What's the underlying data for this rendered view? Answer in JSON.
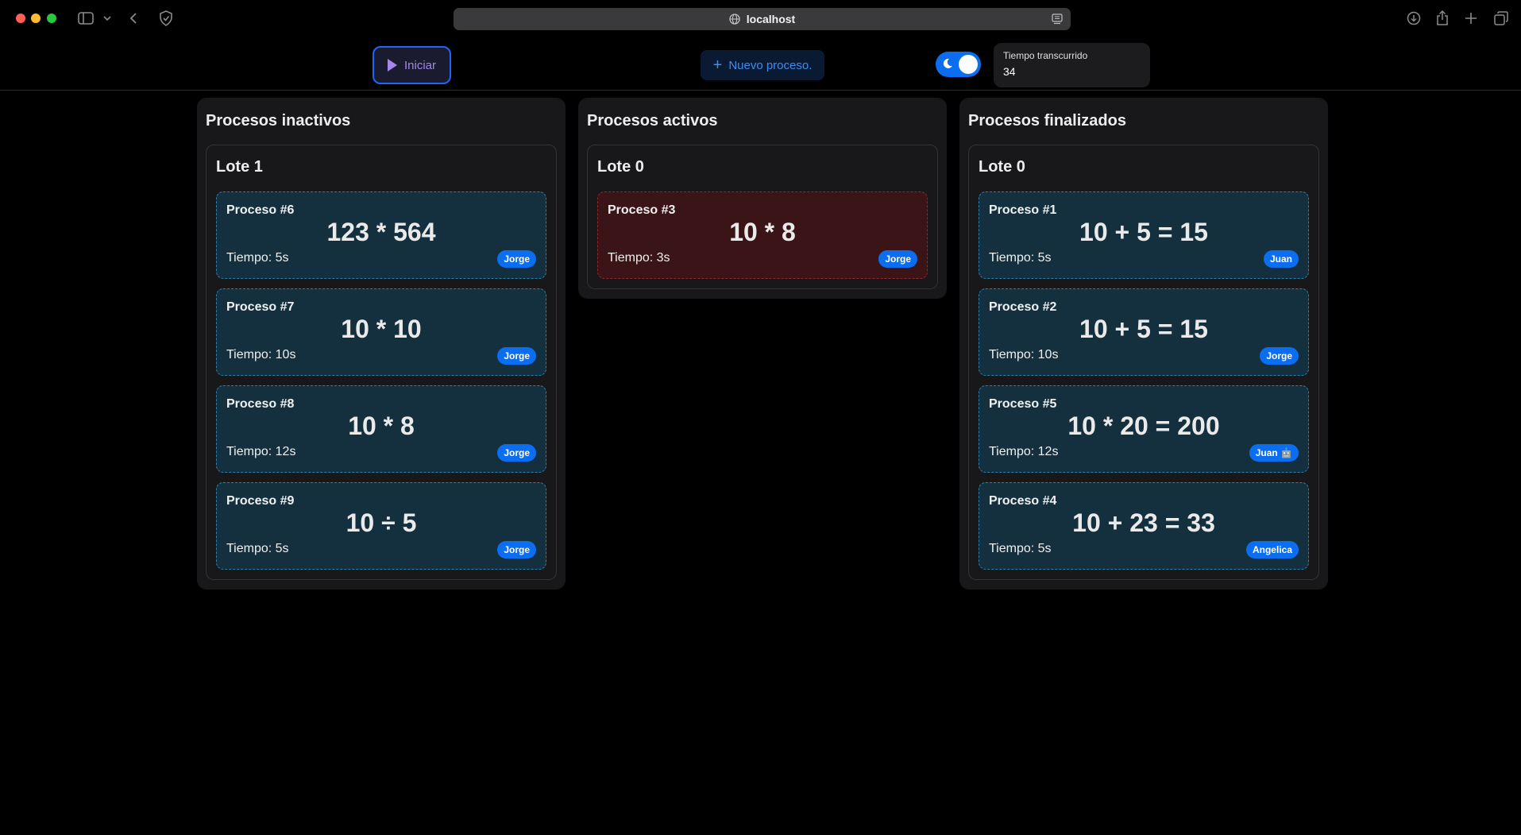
{
  "browser": {
    "url": "localhost"
  },
  "toolbar": {
    "start_label": "Iniciar",
    "new_label": "Nuevo proceso.",
    "timer_label": "Tiempo transcurrido",
    "timer_value": "34",
    "theme_toggle_on": true
  },
  "columns": [
    {
      "title": "Procesos inactivos",
      "lote": "Lote 1",
      "cards": [
        {
          "title": "Proceso #6",
          "op": "123 * 564",
          "time": "Tiempo: 5s",
          "user": "Jorge"
        },
        {
          "title": "Proceso #7",
          "op": "10 * 10",
          "time": "Tiempo: 10s",
          "user": "Jorge"
        },
        {
          "title": "Proceso #8",
          "op": "10 * 8",
          "time": "Tiempo: 12s",
          "user": "Jorge"
        },
        {
          "title": "Proceso #9",
          "op": "10 ÷ 5",
          "time": "Tiempo: 5s",
          "user": "Jorge"
        }
      ]
    },
    {
      "title": "Procesos activos",
      "lote": "Lote 0",
      "cards": [
        {
          "title": "Proceso #3",
          "op": "10 * 8",
          "time": "Tiempo: 3s",
          "user": "Jorge"
        }
      ]
    },
    {
      "title": "Procesos finalizados",
      "lote": "Lote 0",
      "cards": [
        {
          "title": "Proceso #1",
          "op": "10 + 5 = 15",
          "time": "Tiempo: 5s",
          "user": "Juan"
        },
        {
          "title": "Proceso #2",
          "op": "10 + 5 = 15",
          "time": "Tiempo: 10s",
          "user": "Jorge"
        },
        {
          "title": "Proceso #5",
          "op": "10 * 20 = 200",
          "time": "Tiempo: 12s",
          "user": "Juan 🤖"
        },
        {
          "title": "Proceso #4",
          "op": "10 + 23 = 33",
          "time": "Tiempo: 5s",
          "user": "Angelica"
        }
      ]
    }
  ]
}
